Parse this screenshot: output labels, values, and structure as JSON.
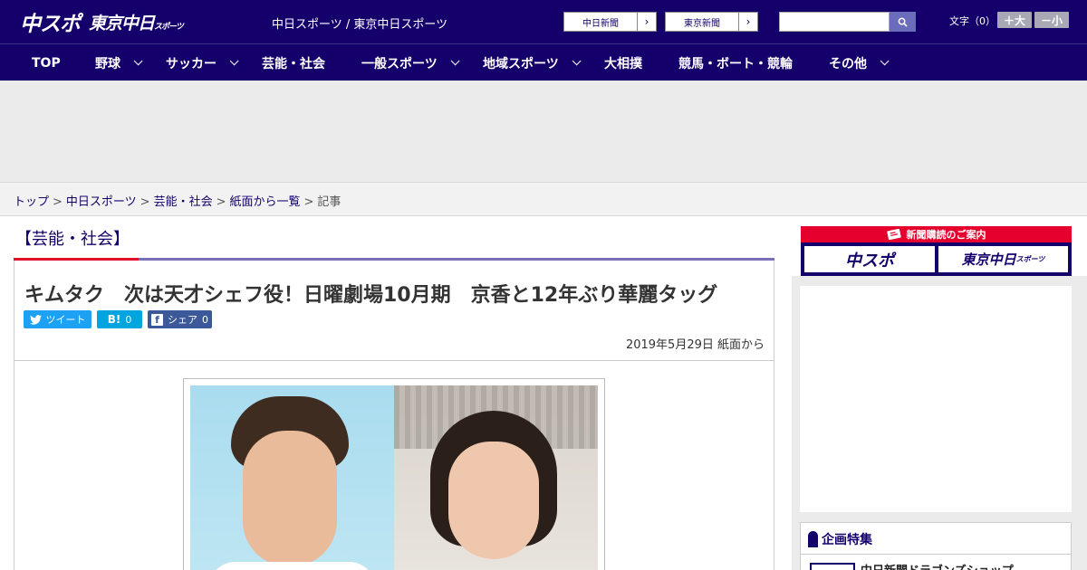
{
  "header": {
    "logo_main": "中スポ",
    "logo_sub": "東京中日",
    "logo_sub_small": "スポーツ",
    "site_title": "中日スポーツ / 東京中日スポーツ",
    "paper_links": [
      "中日新聞",
      "東京新聞"
    ],
    "search_placeholder": "",
    "font_size_label": "文字（0）",
    "font_bigger": "＋大",
    "font_smaller": "－小"
  },
  "nav": {
    "items": [
      {
        "label": "TOP",
        "has_menu": false
      },
      {
        "label": "野球",
        "has_menu": true
      },
      {
        "label": "サッカー",
        "has_menu": true
      },
      {
        "label": "芸能・社会",
        "has_menu": false
      },
      {
        "label": "一般スポーツ",
        "has_menu": true
      },
      {
        "label": "地域スポーツ",
        "has_menu": true
      },
      {
        "label": "大相撲",
        "has_menu": false
      },
      {
        "label": "競馬・ボート・競輪",
        "has_menu": false
      },
      {
        "label": "その他",
        "has_menu": true
      }
    ]
  },
  "breadcrumb": {
    "items": [
      "トップ",
      "中日スポーツ",
      "芸能・社会",
      "紙面から一覧"
    ],
    "current": "記事",
    "separator": ">"
  },
  "article": {
    "category": "【芸能・社会】",
    "title": "キムタク　次は天才シェフ役！日曜劇場10月期　京香と12年ぶり華麗タッグ",
    "share": {
      "tweet": "ツイート",
      "hatena_icon": "B!",
      "hatena_count": "0",
      "facebook_label": "シェア",
      "facebook_count": "0"
    },
    "date": "2019年5月29日 紙面から"
  },
  "sidebar": {
    "subscription_title": "新聞購読のご案内",
    "subscription_logo_a": "中スポ",
    "subscription_logo_b": "東京中日",
    "subscription_logo_b_small": "スポーツ",
    "feature_title": "企画特集",
    "feature_item": "中日新聞ドラゴンズショップ"
  },
  "colors": {
    "brand_navy": "#15006b",
    "accent_red": "#e0102a",
    "twitter": "#1da1f2",
    "hatena": "#00a4de",
    "facebook": "#3b5998"
  }
}
